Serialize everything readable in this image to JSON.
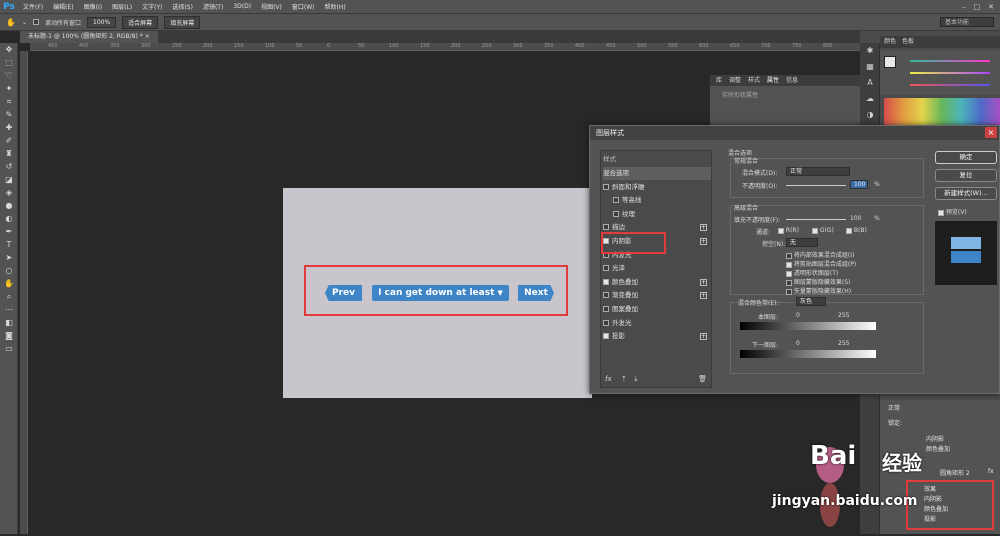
{
  "app": {
    "logo": "Ps"
  },
  "menubar": {
    "items": [
      "文件(F)",
      "编辑(E)",
      "图像(I)",
      "图层(L)",
      "文字(Y)",
      "选择(S)",
      "滤镜(T)",
      "3D(D)",
      "视图(V)",
      "窗口(W)",
      "帮助(H)"
    ]
  },
  "options": {
    "scroll_all": "滚动所有窗口",
    "zoom": "100%",
    "fit_screen": "适合屏幕",
    "fill_screen": "填充屏幕",
    "workspace": "基本功能"
  },
  "tab": {
    "title": "未标题-1 @ 100% (圆角矩形 2, RGB/8) *"
  },
  "ruler": {
    "ticks": [
      "450",
      "400",
      "350",
      "300",
      "250",
      "200",
      "150",
      "100",
      "50",
      "0",
      "50",
      "100",
      "150",
      "200",
      "250",
      "300",
      "350",
      "400",
      "450",
      "500",
      "550",
      "600",
      "650",
      "700",
      "750",
      "800"
    ]
  },
  "canvas": {
    "prev": "Prev",
    "middle": "I can get down at least",
    "dropdown": "▼",
    "next": "Next"
  },
  "color_panel": {
    "tabs": [
      "颜色",
      "色板"
    ],
    "accent": "#31a8ff"
  },
  "props_panel": {
    "tabs": [
      "库",
      "调整",
      "样式",
      "属性",
      "信息"
    ],
    "subtitle": "实时形状属性"
  },
  "layers_panel": {
    "mode": "正常",
    "lock": "锁定:",
    "effects": [
      "内阴影",
      "颜色叠加"
    ],
    "layer_name": "圆角矩形 2",
    "fx": "fx",
    "effects2": [
      "效果",
      "内阴影",
      "颜色叠加",
      "投影"
    ]
  },
  "dialog": {
    "title": "图层样式",
    "list_header": "样式",
    "styles": [
      {
        "label": "混合选项",
        "checked": false,
        "plus": false,
        "indent": false,
        "noCheck": true
      },
      {
        "label": "斜面和浮雕",
        "checked": false,
        "plus": false,
        "indent": false
      },
      {
        "label": "等高线",
        "checked": false,
        "plus": false,
        "indent": true
      },
      {
        "label": "纹理",
        "checked": false,
        "plus": false,
        "indent": true
      },
      {
        "label": "描边",
        "checked": false,
        "plus": true,
        "indent": false
      },
      {
        "label": "内阴影",
        "checked": true,
        "plus": true,
        "indent": false
      },
      {
        "label": "内发光",
        "checked": false,
        "plus": false,
        "indent": false
      },
      {
        "label": "光泽",
        "checked": false,
        "plus": false,
        "indent": false
      },
      {
        "label": "颜色叠加",
        "checked": true,
        "plus": true,
        "indent": false
      },
      {
        "label": "渐变叠加",
        "checked": false,
        "plus": true,
        "indent": false
      },
      {
        "label": "图案叠加",
        "checked": false,
        "plus": false,
        "indent": false
      },
      {
        "label": "外发光",
        "checked": false,
        "plus": false,
        "indent": false
      },
      {
        "label": "投影",
        "checked": true,
        "plus": true,
        "indent": false
      }
    ],
    "blend_opts": "混合选项",
    "general_blend": "常规混合",
    "blend_mode_label": "混合模式(D):",
    "blend_mode": "正常",
    "opacity_label": "不透明度(O):",
    "opacity": "100",
    "pct": "%",
    "advanced_blend": "高级混合",
    "fill_opacity_label": "填充不透明度(F):",
    "fill_opacity": "100",
    "channels_label": "通道:",
    "ch_r": "R(R)",
    "ch_g": "G(G)",
    "ch_b": "B(B)",
    "knockout_label": "挖空(N):",
    "knockout": "无",
    "adv_checks": [
      {
        "label": "将内部效果混合成组(I)",
        "checked": false
      },
      {
        "label": "将剪贴图层混合成组(P)",
        "checked": true
      },
      {
        "label": "透明形状图层(T)",
        "checked": true
      },
      {
        "label": "图层蒙版隐藏效果(S)",
        "checked": false
      },
      {
        "label": "矢量蒙版隐藏效果(H)",
        "checked": false
      }
    ],
    "blend_if_label": "混合颜色带(E):",
    "blend_if": "灰色",
    "this_layer": "本图层:",
    "underlying": "下一图层:",
    "v0": "0",
    "v255": "255",
    "ok": "确定",
    "reset": "复位",
    "new_style": "新建样式(W)...",
    "preview": "预览(V)",
    "footer_fx": "fx"
  },
  "watermark": {
    "brand": "Bai",
    "brand2": "经验",
    "url": "jingyan.baidu.com"
  }
}
